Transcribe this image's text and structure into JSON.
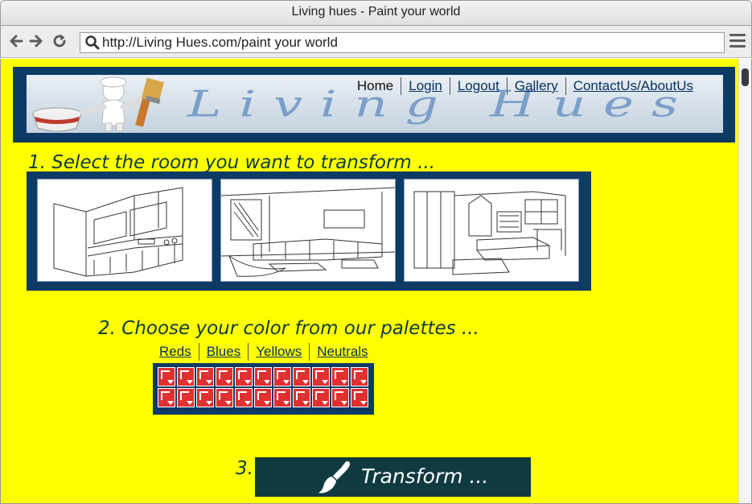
{
  "browser": {
    "window_title": "Living hues - Paint your world",
    "url": "http://Living Hues.com/paint your world",
    "back_icon": "arrow-left-icon",
    "forward_icon": "arrow-right-icon",
    "reload_icon": "reload-icon",
    "menu_icon": "hamburger-menu-icon"
  },
  "header": {
    "logo_text": "Living Hues",
    "nav": [
      {
        "label": "Home"
      },
      {
        "label": "Login"
      },
      {
        "label": "Logout"
      },
      {
        "label": "Gallery"
      },
      {
        "label": "ContactUs/AboutUs"
      }
    ]
  },
  "step1": {
    "heading": "1. Select the room you want to transform ...",
    "rooms": [
      "kitchen",
      "living-room",
      "bedroom"
    ]
  },
  "step2": {
    "heading": "2. Choose  your color from our palettes ...",
    "tabs": [
      {
        "label": "Reds"
      },
      {
        "label": "Blues"
      },
      {
        "label": "Yellows"
      },
      {
        "label": "Neutrals"
      }
    ],
    "swatch_color": "#e03030",
    "rows": 2,
    "cols": 11
  },
  "step3": {
    "number": "3.",
    "button_label": "Transform ..."
  },
  "colors": {
    "page_background": "#ffff00",
    "navy": "#0e3a66",
    "button": "#0e3a40"
  }
}
